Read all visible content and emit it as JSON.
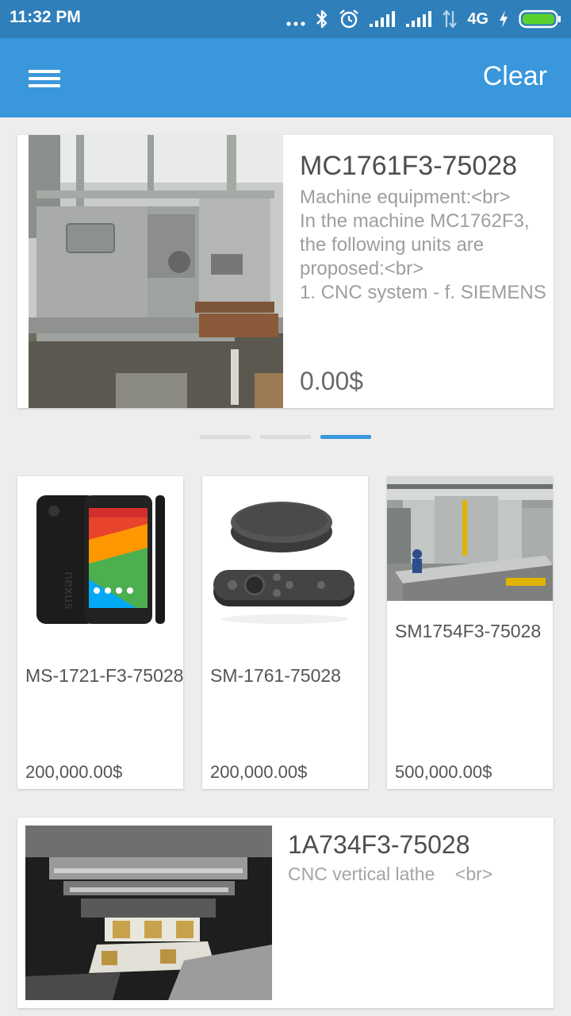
{
  "status_bar": {
    "time": "11:32 PM",
    "network_label": "4G",
    "icons": [
      "more-dots-icon",
      "bluetooth-icon",
      "alarm-icon",
      "signal-icon",
      "signal-icon",
      "data-arrows-icon",
      "charging-icon",
      "battery-icon"
    ],
    "battery_color": "#5bd12e"
  },
  "app_bar": {
    "menu_icon": "hamburger-menu-icon",
    "clear_label": "Clear",
    "color": "#3a97db"
  },
  "featured": {
    "title": "MC1761F3-75028",
    "description_lines": [
      "Machine equipment:<br>",
      "In the machine MC1762F3,",
      "the following units are",
      "proposed:<br>",
      "1. CNC system - f. SIEMENS"
    ],
    "price": "0.00$",
    "image": "cnc-lathe-machine-photo"
  },
  "pager": {
    "count": 3,
    "active_index": 2,
    "accent": "#3a97db"
  },
  "products": [
    {
      "title": "MS-1721-F3-75028",
      "price": "200,000.00$",
      "image": "smartphone-photo"
    },
    {
      "title": "SM-1761-75028",
      "price": "200,000.00$",
      "image": "media-player-remote-photo"
    },
    {
      "title": "SM1754F3-75028",
      "price": "500,000.00$",
      "image": "factory-floor-photo"
    }
  ],
  "bottom": {
    "title": "1A734F3-75028",
    "description": "CNC vertical lathe    <br>",
    "image": "milling-tool-photo"
  }
}
